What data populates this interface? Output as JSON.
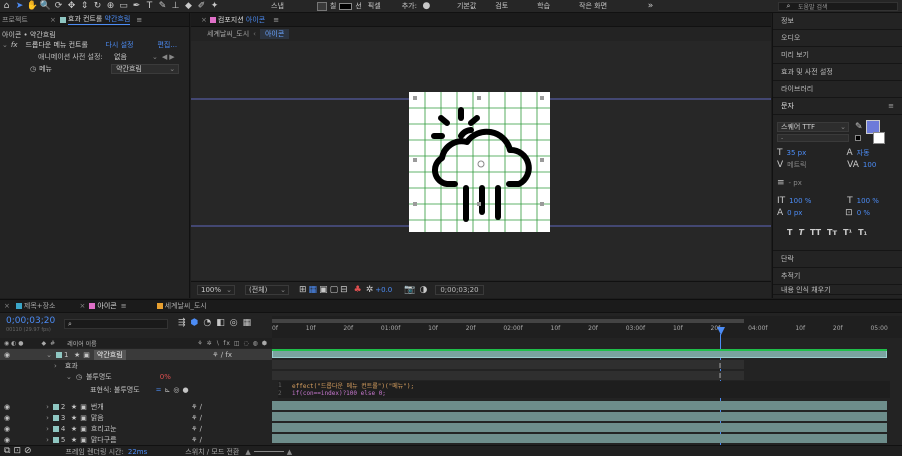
{
  "toolbar": {
    "snap_label": "스냅",
    "color_swatch_label": "칠",
    "stroke_label": "선",
    "stroke_value": "픽셀",
    "add_label": "추가:",
    "workspaces": [
      "기본값",
      "검토",
      "학습",
      "작은 화면"
    ],
    "search_placeholder": "도움말 검색"
  },
  "effects": {
    "tab_project": "프로젝트",
    "tab_effects_prefix": "효과 컨트롤",
    "tab_effects_layer": "약간흐림",
    "breadcrumb": "아이콘 • 약간흐림",
    "effect_name": "드롭다운 메뉴 컨트롤",
    "reset_label": "다시 설정",
    "edit_label": "편집...",
    "preset_label": "애니메이션 사전 설정:",
    "preset_value": "없음",
    "menu_label": "메뉴",
    "menu_value": "약간흐림"
  },
  "comp": {
    "tab_label_prefix": "컴포지션",
    "tab_label_name": "아이콘",
    "crumb_1": "세계날씨_도시",
    "crumb_2": "아이콘",
    "zoom": "100%",
    "quality": "(전체)",
    "exposure": "+0.0",
    "timecode": "0;00;03;20"
  },
  "right_panel": {
    "items": [
      "정보",
      "오디오",
      "미리 보기",
      "효과 및 사전 설정",
      "라이브러리"
    ],
    "char_title": "문자",
    "font": "스퀘어 TTF",
    "font_size": "35 px",
    "leading": "자동",
    "kerning": "메트릭",
    "tracking": "100",
    "stroke_px": "- px",
    "vscale": "100 %",
    "hscale": "100 %",
    "baseline": "0 px",
    "tsume": "0 %",
    "bottom_items": [
      "단락",
      "추적기",
      "내용 인식 채우기"
    ]
  },
  "timeline": {
    "tabs": [
      "제목+장소",
      "아이콘",
      "세계날씨_도시"
    ],
    "timecode": "0;00;03;20",
    "frame_info": "00110 (29.97 fps)",
    "col_layer_name": "레이어 이름",
    "ruler": [
      "0f",
      "10f",
      "20f",
      "01:00f",
      "10f",
      "20f",
      "02:00f",
      "10f",
      "20f",
      "03:00f",
      "10f",
      "20f",
      "04:00f",
      "10f",
      "20f",
      "05:00"
    ],
    "layers": [
      {
        "num": "1",
        "name": "약간흐림"
      },
      {
        "num": "2",
        "name": "번개"
      },
      {
        "num": "3",
        "name": "맑음"
      },
      {
        "num": "4",
        "name": "흐리고눈"
      },
      {
        "num": "5",
        "name": "맑다구름"
      }
    ],
    "sub_effect": "효과",
    "sub_opacity": "불투명도",
    "opacity_value": "0%",
    "expr_label": "표현식: 불투명도",
    "expr_line1": "effect(\"드롭다운 메뉴 컨트롤\")(\"메뉴\");",
    "expr_line2": "if(con==index)?100 else 0;",
    "render_label": "프레임 렌더링 시간:",
    "render_value": "22ms",
    "switch_mode": "스위치 / 모드 전환"
  },
  "colors": {
    "accent": "#4c8cf5",
    "grid_green": "#2e9a3a",
    "bar": "#6d8d8b",
    "selected_bar": "#7aa3a0"
  }
}
